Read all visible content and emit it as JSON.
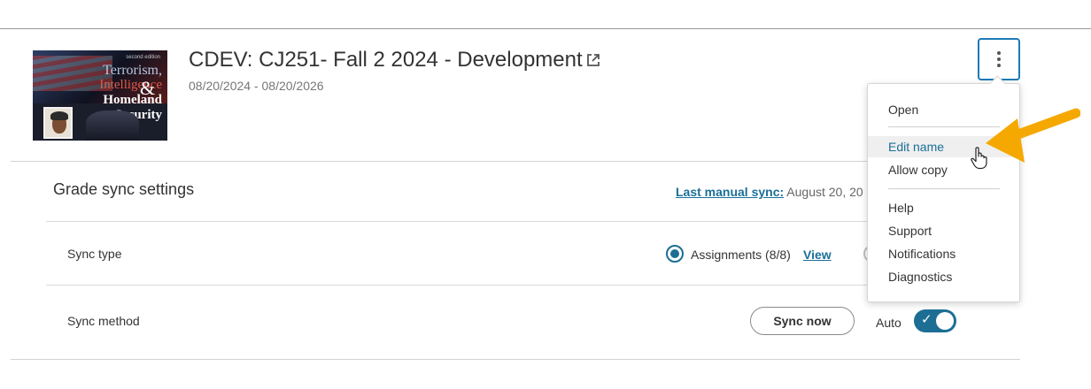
{
  "course": {
    "title": "CDEV: CJ251- Fall 2 2024 - Development",
    "dates": "08/20/2024 - 08/20/2026",
    "cover": {
      "edition": "second edition",
      "line1": "Terrorism,",
      "line2": "Intelligence",
      "line3": "Homeland",
      "line4": "Security",
      "ampersand": "&"
    },
    "external_link_icon": "external-link-icon",
    "more_icon": "vertical-ellipsis-icon"
  },
  "grade_sync": {
    "section_title": "Grade sync settings",
    "last_sync_label": "Last manual sync:",
    "last_sync_value": "August 20, 20",
    "sync_type_label": "Sync type",
    "sync_type_option": "Assignments (8/8)",
    "view_link": "View",
    "sync_method_label": "Sync method",
    "sync_now_button": "Sync now",
    "auto_label": "Auto",
    "auto_enabled": true
  },
  "menu": {
    "items": [
      {
        "label": "Open"
      },
      {
        "label": "Edit name"
      },
      {
        "label": "Allow copy"
      },
      {
        "label": "Help"
      },
      {
        "label": "Support"
      },
      {
        "label": "Notifications"
      },
      {
        "label": "Diagnostics"
      }
    ],
    "hovered": "Edit name"
  },
  "colors": {
    "accent": "#1c6e94",
    "link": "#1a6f98",
    "annotation_arrow": "#f5a800"
  }
}
